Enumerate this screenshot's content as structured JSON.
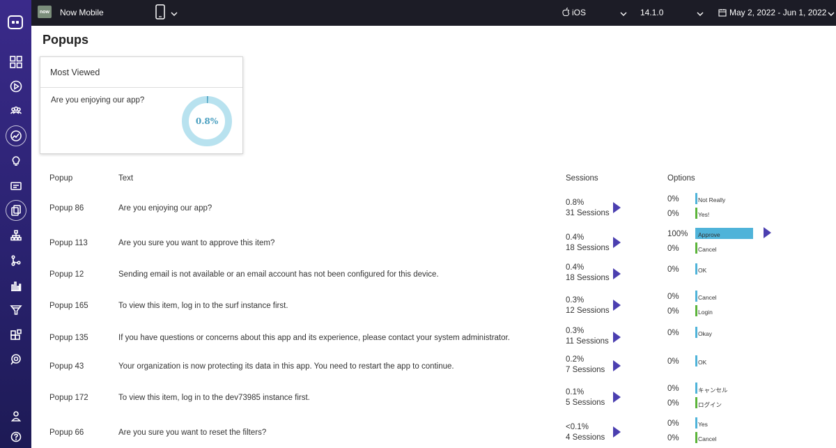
{
  "topbar": {
    "app_logo": "now",
    "app_name": "Now Mobile",
    "os": "iOS",
    "version": "14.1.0",
    "date_range": "May 2, 2022 - Jun 1, 2022"
  },
  "page": {
    "title": "Popups"
  },
  "most_viewed": {
    "title": "Most Viewed",
    "question": "Are you enjoying our app?",
    "percent_label": "0.8%",
    "percent": 0.8
  },
  "table": {
    "headers": {
      "popup": "Popup",
      "text": "Text",
      "sessions": "Sessions",
      "options": "Options"
    },
    "rows": [
      {
        "popup": "Popup 86",
        "text": "Are you enjoying our app?",
        "pct": "0.8%",
        "sessions": "31 Sessions",
        "options": [
          {
            "pct": "0%",
            "label": "Not Really",
            "value": 0,
            "color": "#4fb3d9"
          },
          {
            "pct": "0%",
            "label": "Yes!",
            "value": 0,
            "color": "#5bb43a"
          }
        ]
      },
      {
        "popup": "Popup 113",
        "text": "Are you sure you want to approve this item?",
        "pct": "0.4%",
        "sessions": "18 Sessions",
        "options": [
          {
            "pct": "100%",
            "label": "Approve",
            "value": 100,
            "color": "#4fb3d9"
          },
          {
            "pct": "0%",
            "label": "Cancel",
            "value": 0,
            "color": "#5bb43a"
          }
        ]
      },
      {
        "popup": "Popup 12",
        "text": "Sending email is not available or an email account has not been configured for this device.",
        "pct": "0.4%",
        "sessions": "18 Sessions",
        "options": [
          {
            "pct": "0%",
            "label": "OK",
            "value": 0,
            "color": "#4fb3d9"
          }
        ]
      },
      {
        "popup": "Popup 165",
        "text": "To view this item, log in to the surf instance first.",
        "pct": "0.3%",
        "sessions": "12 Sessions",
        "options": [
          {
            "pct": "0%",
            "label": "Cancel",
            "value": 0,
            "color": "#4fb3d9"
          },
          {
            "pct": "0%",
            "label": "Login",
            "value": 0,
            "color": "#5bb43a"
          }
        ]
      },
      {
        "popup": "Popup 135",
        "text": "If you have questions or concerns about this app and its experience, please contact your system administrator.",
        "pct": "0.3%",
        "sessions": "11 Sessions",
        "options": [
          {
            "pct": "0%",
            "label": "Okay",
            "value": 0,
            "color": "#4fb3d9"
          }
        ]
      },
      {
        "popup": "Popup 43",
        "text": "Your organization is now protecting its data in this app. You need to restart the app to continue.",
        "pct": "0.2%",
        "sessions": "7 Sessions",
        "options": [
          {
            "pct": "0%",
            "label": "OK",
            "value": 0,
            "color": "#4fb3d9"
          }
        ]
      },
      {
        "popup": "Popup 172",
        "text": "To view this item, log in to the dev73985 instance first.",
        "pct": "0.1%",
        "sessions": "5 Sessions",
        "options": [
          {
            "pct": "0%",
            "label": "キャンセル",
            "value": 0,
            "color": "#4fb3d9"
          },
          {
            "pct": "0%",
            "label": "ログイン",
            "value": 0,
            "color": "#5bb43a"
          }
        ]
      },
      {
        "popup": "Popup 66",
        "text": "Are you sure you want to reset the filters?",
        "pct": "<0.1%",
        "sessions": "4 Sessions",
        "options": [
          {
            "pct": "0%",
            "label": "Yes",
            "value": 0,
            "color": "#4fb3d9"
          },
          {
            "pct": "0%",
            "label": "Cancel",
            "value": 0,
            "color": "#5bb43a"
          }
        ]
      }
    ]
  },
  "colors": {
    "accent": "#4b3fb0",
    "donut": "#b8e2ef",
    "donut_text": "#4a9fc0"
  }
}
